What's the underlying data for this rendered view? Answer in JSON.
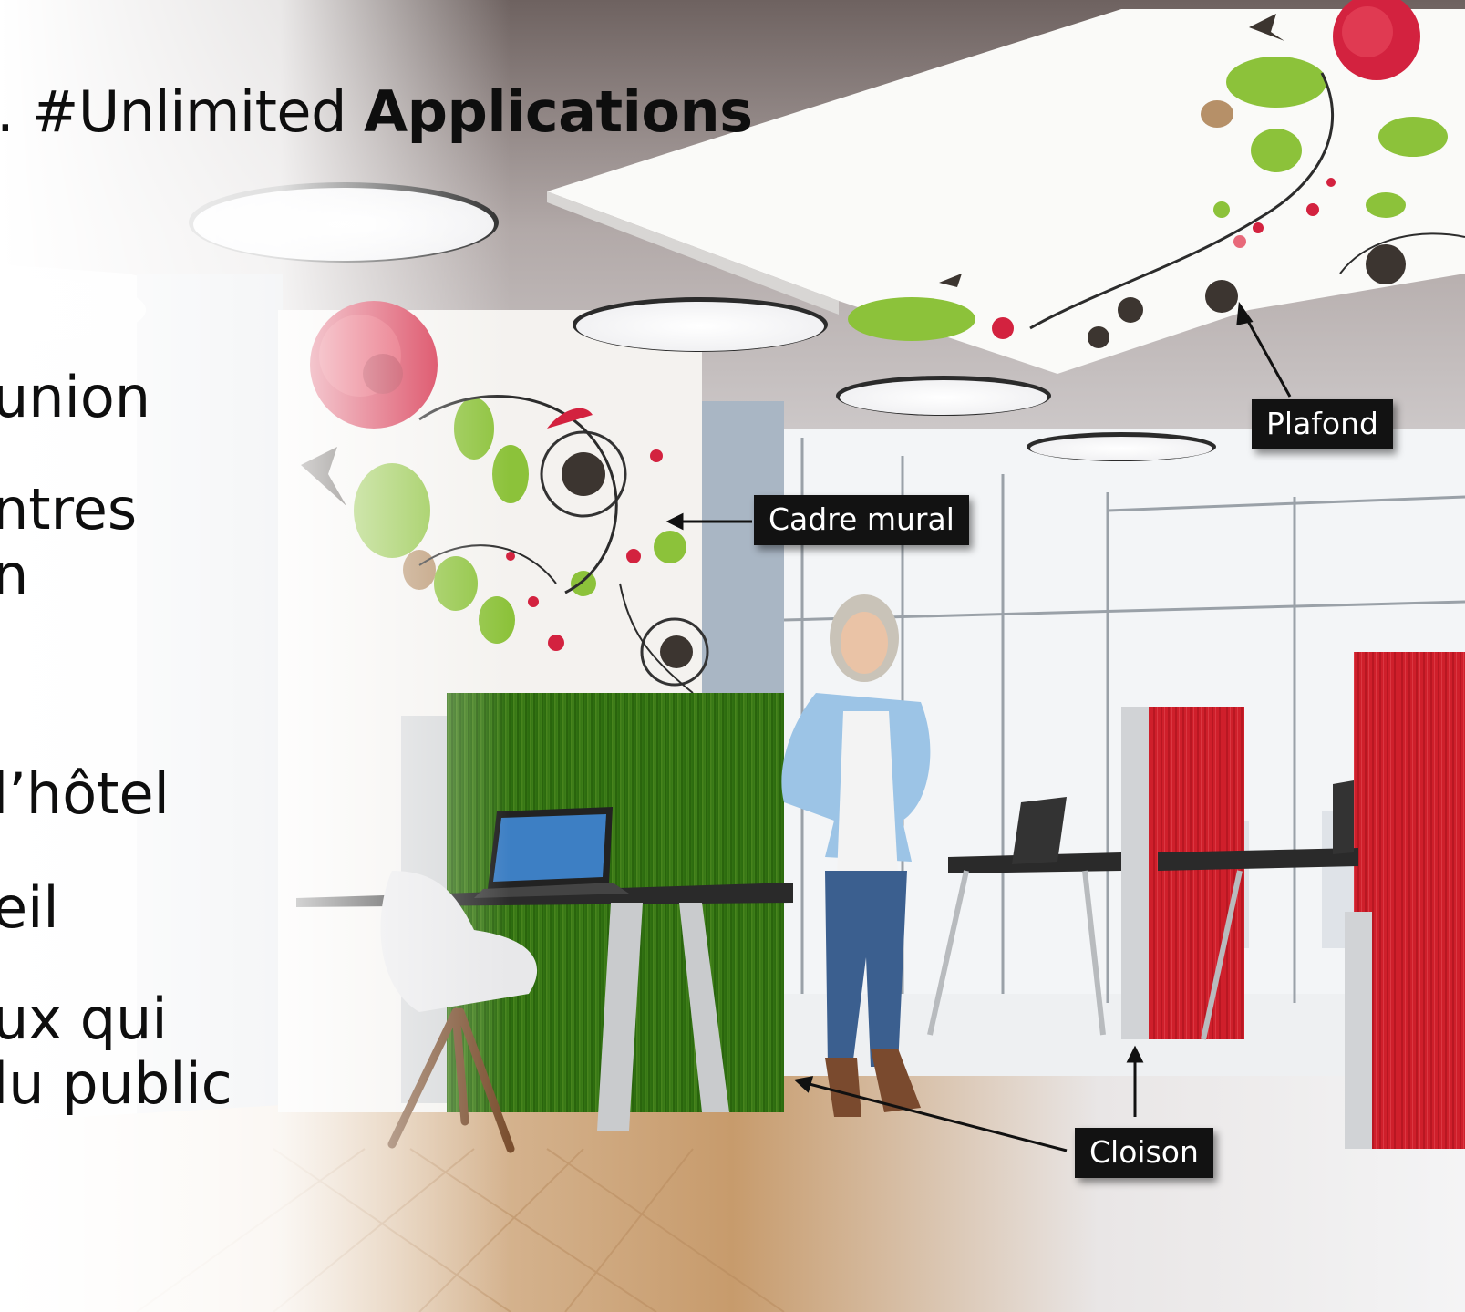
{
  "title": {
    "prefix": ". #Unlimited ",
    "bold": "Applications"
  },
  "bullets": [
    "union",
    "ntres",
    "n",
    "l’hôtel",
    "eil",
    "ux qui",
    "lu public"
  ],
  "callouts": {
    "ceiling": "Plafond",
    "wall_frame": "Cadre mural",
    "partition": "Cloison"
  },
  "colors": {
    "accent_red": "#d3223f",
    "leaf_green": "#8cc23a",
    "partition_green": "#2f6e12",
    "label_bg": "#121212"
  }
}
